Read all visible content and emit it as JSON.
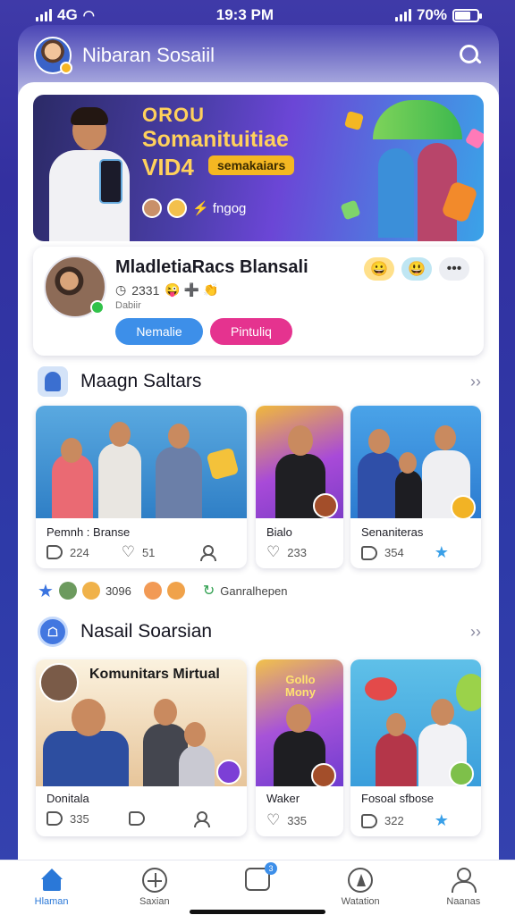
{
  "status_bar": {
    "signal_label": "4G",
    "time": "19:3 PM",
    "battery": "70%",
    "battery_level": 0.7
  },
  "header": {
    "title": "Nibaran Sosaiil",
    "avatar_icon": "user-avatar",
    "search_icon": "search-icon"
  },
  "banner": {
    "line1": "OROU",
    "line2": "Somanituitiae",
    "line3": "VID4",
    "tag": "semakaiars",
    "chip_text": "⚡ fngog"
  },
  "profile_card": {
    "name": "MladletiaRacs Blansali",
    "meta": "2331",
    "meta_emoji": "😜 ➕ 👏",
    "sub": "Dabiir",
    "button_primary": "Nemalie",
    "button_secondary": "Pintuliq",
    "reaction_1": "😀",
    "reaction_2": "😃",
    "reaction_3": "•••"
  },
  "section1": {
    "title": "Maagn Saltars",
    "more": "››",
    "cards": [
      {
        "title": "Pemnh : Branse",
        "likes": "224",
        "hearts": "51"
      },
      {
        "title": "Bialo",
        "hearts": "233"
      },
      {
        "title": "Senaniteras",
        "likes": "354"
      }
    ]
  },
  "middle_row": {
    "count": "3096",
    "label": "Ganralhepen"
  },
  "section2": {
    "title": "Nasail Soarsian",
    "more": "››",
    "feature_title": "Komunitars Mirtual",
    "mini_text": "Gollo Mony",
    "cards": [
      {
        "title": "Donitala",
        "likes": "335"
      },
      {
        "title": "Waker",
        "hearts": "335"
      },
      {
        "title": "Fosoal sfbose",
        "likes": "322"
      }
    ]
  },
  "bottom_nav": {
    "items": [
      {
        "label": "Hlaman",
        "icon": "home-icon"
      },
      {
        "label": "Saxian",
        "icon": "explore-icon"
      },
      {
        "label": "",
        "icon": "grid-icon",
        "badge": "3"
      },
      {
        "label": "Watation",
        "icon": "compass-icon"
      },
      {
        "label": "Naanas",
        "icon": "profile-icon"
      }
    ]
  },
  "colors": {
    "accent": "#3d8fe9",
    "pink": "#e5338f",
    "brand_bg": "#3f3aa8",
    "gold": "#ffd15c"
  }
}
